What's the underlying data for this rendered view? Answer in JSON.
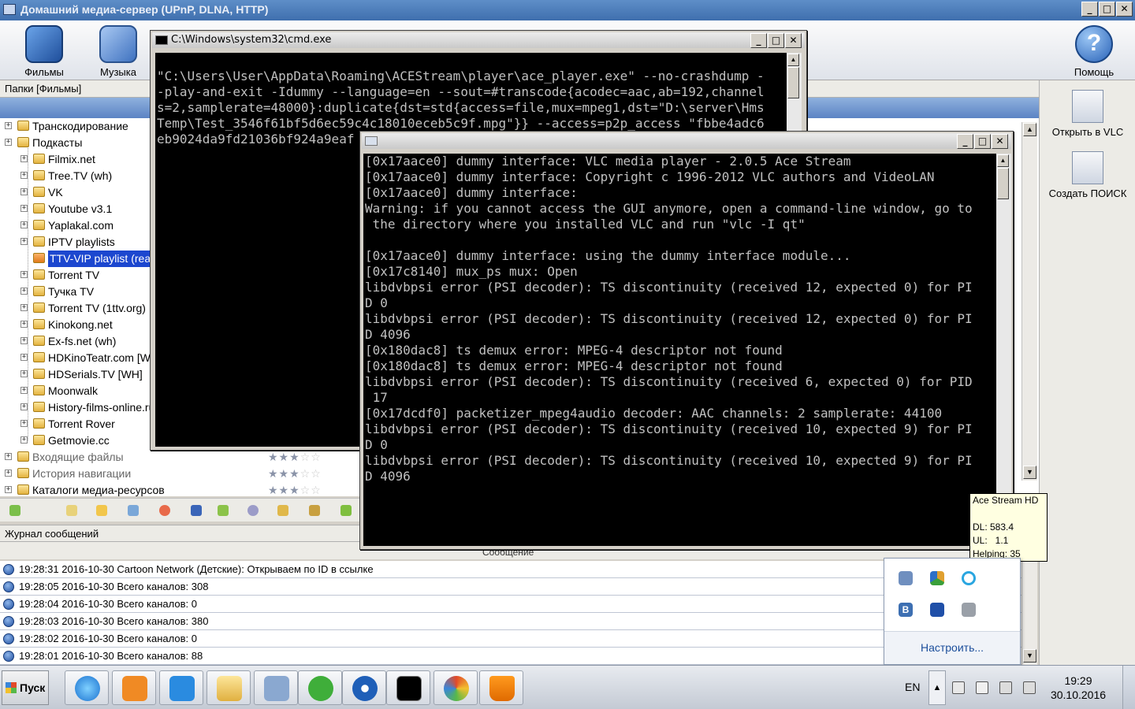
{
  "app": {
    "title": "Домашний медиа-сервер (UPnP, DLNA, HTTP)",
    "toolbar": {
      "films": "Фильмы",
      "music": "Музыка",
      "help": "Помощь"
    },
    "folders_header": "Папки [Фильмы]",
    "tree": [
      {
        "label": "Транскодирование",
        "level": 0,
        "style": "normal"
      },
      {
        "label": "Подкасты",
        "level": 0,
        "style": "normal"
      },
      {
        "label": "Filmix.net",
        "level": 1,
        "style": "normal"
      },
      {
        "label": "Tree.TV (wh)",
        "level": 1,
        "style": "normal"
      },
      {
        "label": "VK",
        "level": 1,
        "style": "normal"
      },
      {
        "label": "Youtube v3.1",
        "level": 1,
        "style": "normal"
      },
      {
        "label": "Yaplakal.com",
        "level": 1,
        "style": "normal"
      },
      {
        "label": "IPTV playlists",
        "level": 1,
        "style": "normal"
      },
      {
        "label": "TTV-VIP playlist (real)",
        "level": 1,
        "style": "selected"
      },
      {
        "label": "Torrent TV",
        "level": 1,
        "style": "normal"
      },
      {
        "label": "Тучка TV",
        "level": 1,
        "style": "normal"
      },
      {
        "label": "Torrent TV (1ttv.org)",
        "level": 1,
        "style": "normal"
      },
      {
        "label": "Kinokong.net",
        "level": 1,
        "style": "normal"
      },
      {
        "label": "Ex-fs.net (wh)",
        "level": 1,
        "style": "normal"
      },
      {
        "label": "HDKinoTeatr.com [W",
        "level": 1,
        "style": "normal"
      },
      {
        "label": "HDSerials.TV [WH]",
        "level": 1,
        "style": "normal"
      },
      {
        "label": "Moonwalk",
        "level": 1,
        "style": "normal"
      },
      {
        "label": "History-films-online.ru",
        "level": 1,
        "style": "normal"
      },
      {
        "label": "Torrent Rover",
        "level": 1,
        "style": "normal"
      },
      {
        "label": "Getmovie.cc",
        "level": 1,
        "style": "normal"
      },
      {
        "label": "Входящие файлы",
        "level": 0,
        "style": "dim"
      },
      {
        "label": "История навигации",
        "level": 0,
        "style": "dim"
      },
      {
        "label": "Каталоги медиа-ресурсов",
        "level": 0,
        "style": "normal"
      }
    ],
    "log_header": "Журнал сообщений",
    "log_column": "Сообщение",
    "log": [
      "19:28:31 2016-10-30 Cartoon Network (Детские): Открываем по ID в ссылке",
      "19:28:05 2016-10-30 Всего каналов: 308",
      "19:28:04 2016-10-30 Всего каналов: 0",
      "19:28:03 2016-10-30 Всего каналов: 380",
      "19:28:02 2016-10-30 Всего каналов: 0",
      "19:28:01 2016-10-30 Всего каналов: 88"
    ],
    "right_panel": {
      "open_vlc": "Открыть в VLC",
      "create_search": "Создать ПОИСК"
    }
  },
  "cmd": {
    "title": "C:\\Windows\\system32\\cmd.exe",
    "text": "\n\"C:\\Users\\User\\AppData\\Roaming\\ACEStream\\player\\ace_player.exe\" --no-crashdump -\n-play-and-exit -Idummy --language=en --sout=#transcode{acodec=aac,ab=192,channel\ns=2,samplerate=48000}:duplicate{dst=std{access=file,mux=mpeg1,dst=\"D:\\server\\Hms\nTemp\\Test_3546f61bf5d6ec59c4c18010eceb5c9f.mpg\"}} --access=p2p_access \"fbbe4adc6\neb9024da9fd21036bf924a9eaf"
  },
  "vlc": {
    "title": "",
    "text": "[0x17aace0] dummy interface: VLC media player - 2.0.5 Ace Stream\n[0x17aace0] dummy interface: Copyright c 1996-2012 VLC authors and VideoLAN\n[0x17aace0] dummy interface:\nWarning: if you cannot access the GUI anymore, open a command-line window, go to\n the directory where you installed VLC and run \"vlc -I qt\"\n\n[0x17aace0] dummy interface: using the dummy interface module...\n[0x17c8140] mux_ps mux: Open\nlibdvbpsi error (PSI decoder): TS discontinuity (received 12, expected 0) for PI\nD 0\nlibdvbpsi error (PSI decoder): TS discontinuity (received 12, expected 0) for PI\nD 4096\n[0x180dac8] ts demux error: MPEG-4 descriptor not found\n[0x180dac8] ts demux error: MPEG-4 descriptor not found\nlibdvbpsi error (PSI decoder): TS discontinuity (received 6, expected 0) for PID\n 17\n[0x17dcdf0] packetizer_mpeg4audio decoder: AAC channels: 2 samplerate: 44100\nlibdvbpsi error (PSI decoder): TS discontinuity (received 10, expected 9) for PI\nD 0\nlibdvbpsi error (PSI decoder): TS discontinuity (received 10, expected 9) for PI\nD 4096"
  },
  "tooltip": {
    "text": "Ace Stream HD\n\nDL: 583.4\nUL:   1.1\nHelping: 35"
  },
  "tray_popup": {
    "configure": "Настроить..."
  },
  "taskbar": {
    "start": "Пуск",
    "lang": "EN",
    "time": "19:29",
    "date": "30.10.2016"
  },
  "window_buttons": {
    "minimize": "_",
    "maximize": "□",
    "close": "✕"
  }
}
